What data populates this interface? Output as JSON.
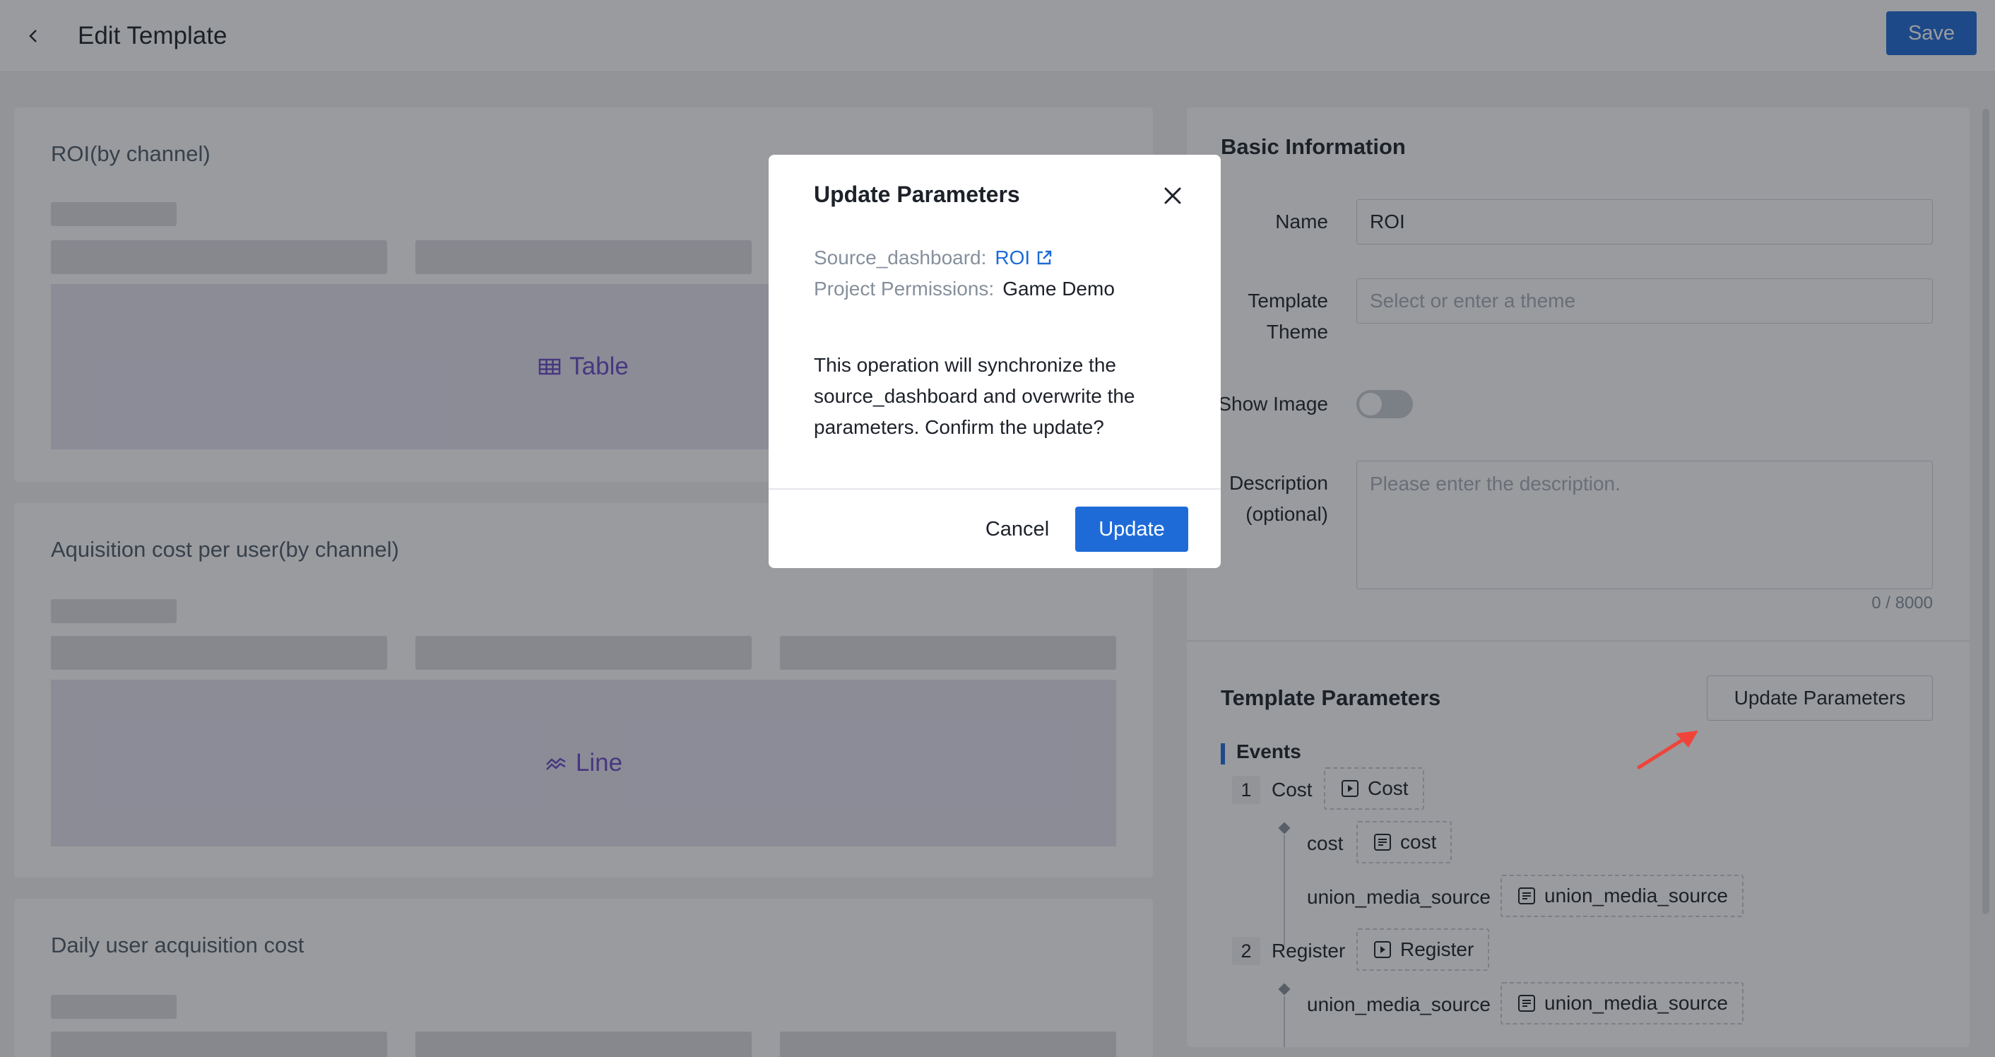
{
  "header": {
    "title": "Edit Template",
    "save_label": "Save"
  },
  "charts": [
    {
      "title": "ROI(by channel)",
      "type_label": "Table",
      "icon": "table-icon"
    },
    {
      "title": "Aquisition cost per user(by channel)",
      "type_label": "Line",
      "icon": "line-chart-icon"
    },
    {
      "title": "Daily user acquisition cost"
    }
  ],
  "basic_info": {
    "title": "Basic Information",
    "name_label": "Name",
    "name_value": "ROI",
    "theme_label": "Template Theme",
    "theme_placeholder": "Select or enter a theme",
    "show_image_label": "Show Image",
    "show_image_on": false,
    "description_label": "Description (optional)",
    "description_placeholder": "Please enter the description.",
    "description_counter": "0 / 8000"
  },
  "template_params": {
    "title": "Template Parameters",
    "update_button_label": "Update Parameters",
    "events_label": "Events",
    "events": [
      {
        "index": "1",
        "name": "Cost",
        "tag": "Cost",
        "properties": [
          {
            "name": "cost",
            "tag": "cost"
          },
          {
            "name": "union_media_source",
            "tag": "union_media_source"
          }
        ]
      },
      {
        "index": "2",
        "name": "Register",
        "tag": "Register",
        "properties": [
          {
            "name": "union_media_source",
            "tag": "union_media_source"
          }
        ]
      }
    ]
  },
  "modal": {
    "title": "Update Parameters",
    "source_key": "Source_dashboard:",
    "source_value": "ROI",
    "permissions_key": "Project Permissions:",
    "permissions_value": "Game Demo",
    "message": "This operation will synchronize the source_dashboard and overwrite the parameters. Confirm the update?",
    "cancel_label": "Cancel",
    "update_label": "Update"
  },
  "colors": {
    "primary": "#1e6bd8",
    "chart_accent": "#6a4ac7",
    "annotation_arrow": "#f0443a"
  }
}
